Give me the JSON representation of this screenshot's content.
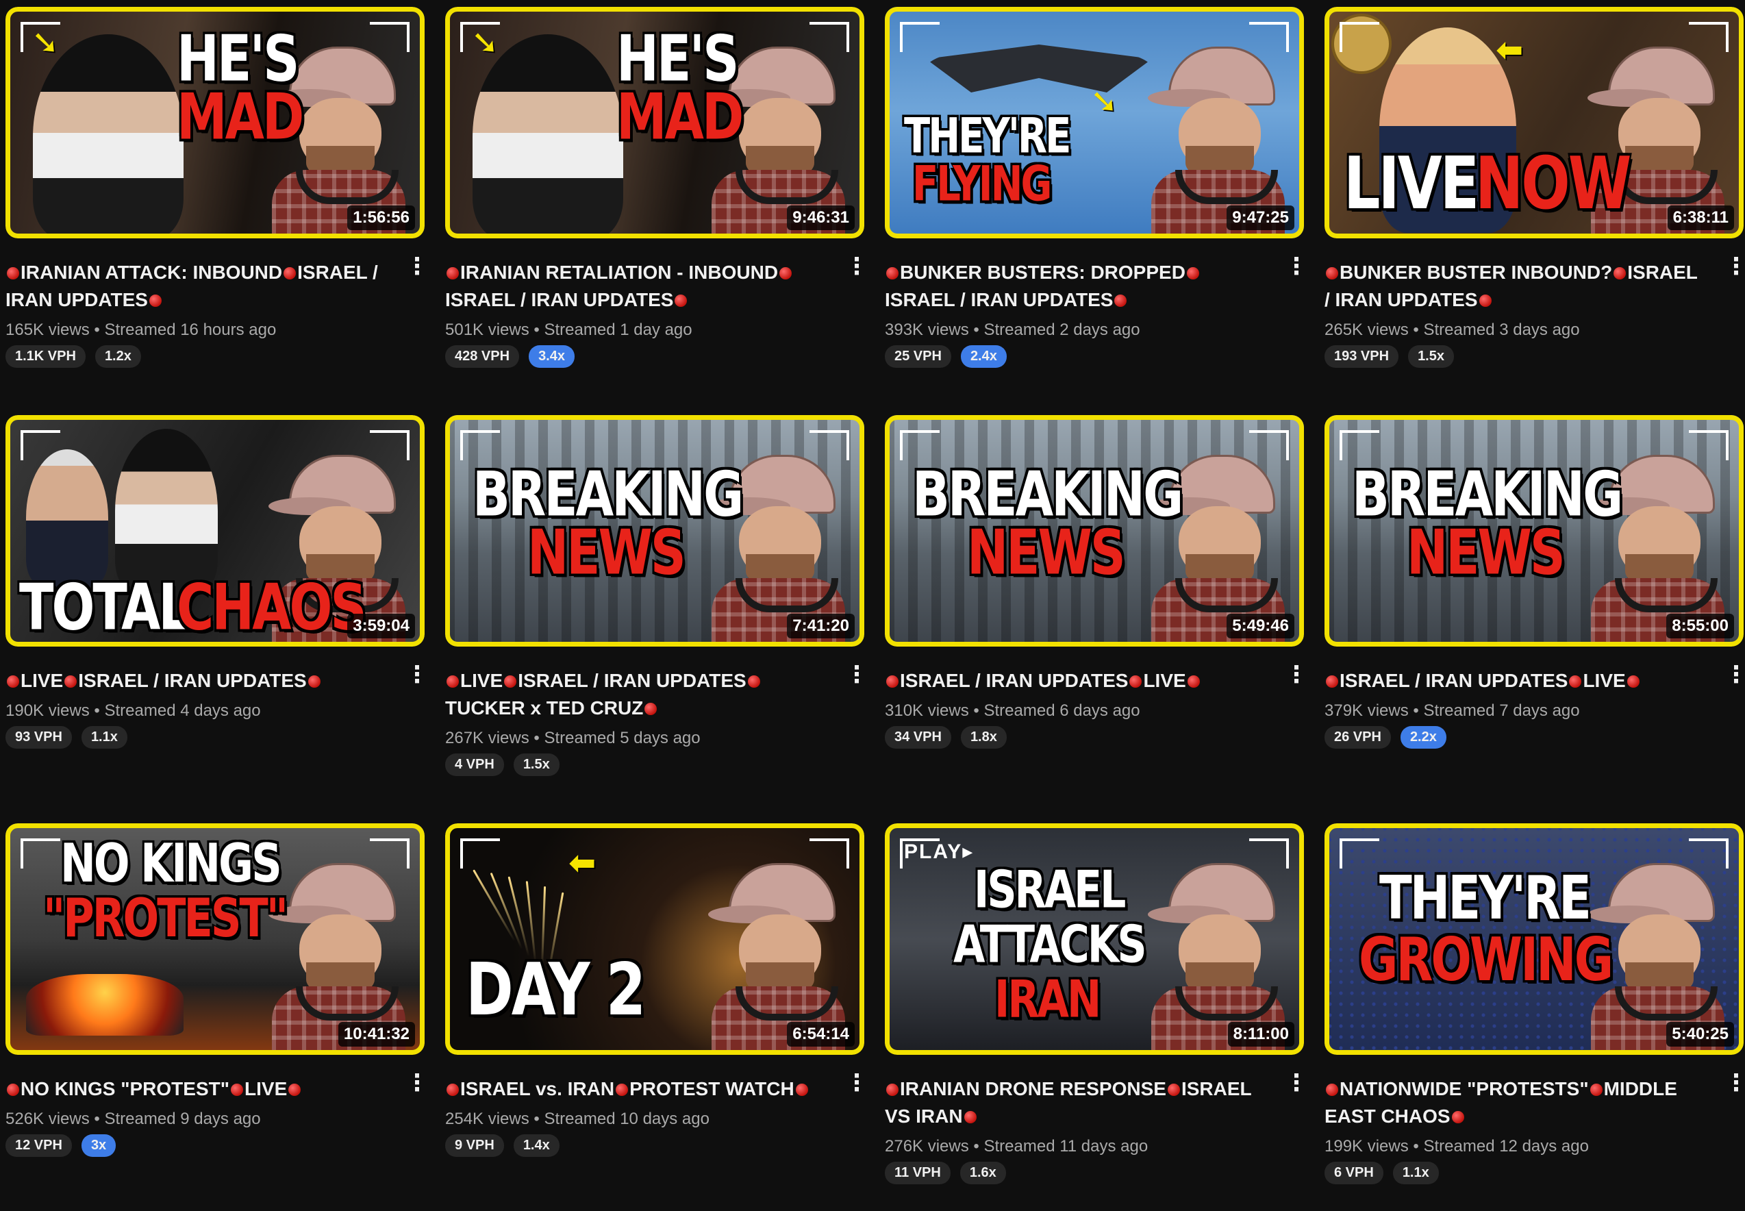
{
  "videos": [
    {
      "title": [
        "",
        "IRANIAN ATTACK: INBOUND",
        "ISRAEL / IRAN UPDATES",
        ""
      ],
      "views": "165K views",
      "streamed": "Streamed 16 hours ago",
      "vph": "1.1K VPH",
      "mult": "1.2x",
      "mult_hi": false,
      "duration": "1:56:56",
      "thumb_lines": [
        "HE'S",
        "MAD"
      ],
      "scene": "cleric"
    },
    {
      "title": [
        "",
        "IRANIAN RETALIATION - INBOUND",
        "ISRAEL / IRAN UPDATES",
        ""
      ],
      "views": "501K views",
      "streamed": "Streamed 1 day ago",
      "vph": "428 VPH",
      "mult": "3.4x",
      "mult_hi": true,
      "duration": "9:46:31",
      "thumb_lines": [
        "HE'S",
        "MAD"
      ],
      "scene": "cleric"
    },
    {
      "title": [
        "",
        "BUNKER BUSTERS: DROPPED",
        "ISRAEL / IRAN UPDATES",
        ""
      ],
      "views": "393K views",
      "streamed": "Streamed 2 days ago",
      "vph": "25 VPH",
      "mult": "2.4x",
      "mult_hi": true,
      "duration": "9:47:25",
      "thumb_lines": [
        "THEY'RE",
        "FLYING"
      ],
      "scene": "jet"
    },
    {
      "title": [
        "",
        "BUNKER BUSTER INBOUND?",
        "ISRAEL / IRAN UPDATES",
        ""
      ],
      "views": "265K views",
      "streamed": "Streamed 3 days ago",
      "vph": "193 VPH",
      "mult": "1.5x",
      "mult_hi": false,
      "duration": "6:38:11",
      "thumb_lines": [
        "LIVE",
        "NOW"
      ],
      "scene": "phone"
    },
    {
      "title": [
        "",
        "LIVE",
        "ISRAEL / IRAN UPDATES",
        ""
      ],
      "views": "190K views",
      "streamed": "Streamed 4 days ago",
      "vph": "93 VPH",
      "mult": "1.1x",
      "mult_hi": false,
      "duration": "3:59:04",
      "thumb_lines": [
        "TOTAL",
        "CHAOS"
      ],
      "scene": "chaos"
    },
    {
      "title": [
        "",
        "LIVE",
        "ISRAEL / IRAN UPDATES",
        "TUCKER x TED CRUZ",
        ""
      ],
      "views": "267K views",
      "streamed": "Streamed 5 days ago",
      "vph": "4 VPH",
      "mult": "1.5x",
      "mult_hi": false,
      "duration": "7:41:20",
      "thumb_lines": [
        "BREAKING",
        "NEWS"
      ],
      "scene": "city"
    },
    {
      "title": [
        "",
        "ISRAEL / IRAN UPDATES",
        "LIVE",
        ""
      ],
      "views": "310K views",
      "streamed": "Streamed 6 days ago",
      "vph": "34 VPH",
      "mult": "1.8x",
      "mult_hi": false,
      "duration": "5:49:46",
      "thumb_lines": [
        "BREAKING",
        "NEWS"
      ],
      "scene": "city"
    },
    {
      "title": [
        "",
        "ISRAEL / IRAN UPDATES",
        "LIVE",
        ""
      ],
      "views": "379K views",
      "streamed": "Streamed 7 days ago",
      "vph": "26 VPH",
      "mult": "2.2x",
      "mult_hi": true,
      "duration": "8:55:00",
      "thumb_lines": [
        "BREAKING",
        "NEWS"
      ],
      "scene": "city"
    },
    {
      "title": [
        "",
        "NO KINGS \"PROTEST\"",
        "LIVE",
        ""
      ],
      "views": "526K views",
      "streamed": "Streamed 9 days ago",
      "vph": "12 VPH",
      "mult": "3x",
      "mult_hi": true,
      "duration": "10:41:32",
      "thumb_lines": [
        "NO KINGS",
        "\"PROTEST\""
      ],
      "scene": "fire"
    },
    {
      "title": [
        "",
        "ISRAEL vs. IRAN",
        "PROTEST WATCH",
        ""
      ],
      "views": "254K views",
      "streamed": "Streamed 10 days ago",
      "vph": "9 VPH",
      "mult": "1.4x",
      "mult_hi": false,
      "duration": "6:54:14",
      "thumb_lines": [
        "DAY 2",
        ""
      ],
      "scene": "night"
    },
    {
      "title": [
        "",
        "IRANIAN DRONE RESPONSE",
        "ISRAEL VS IRAN",
        ""
      ],
      "views": "276K views",
      "streamed": "Streamed 11 days ago",
      "vph": "11 VPH",
      "mult": "1.6x",
      "mult_hi": false,
      "duration": "8:11:00",
      "thumb_lines": [
        "ISRAEL",
        "ATTACKS",
        "IRAN"
      ],
      "scene": "street",
      "tag": "PLAY"
    },
    {
      "title": [
        "",
        "NATIONWIDE \"PROTESTS\"",
        "MIDDLE EAST CHAOS",
        ""
      ],
      "views": "199K views",
      "streamed": "Streamed 12 days ago",
      "vph": "6 VPH",
      "mult": "1.1x",
      "mult_hi": false,
      "duration": "5:40:25",
      "thumb_lines": [
        "THEY'RE",
        "GROWING"
      ],
      "scene": "crowd"
    }
  ],
  "stats_separator": " • ",
  "menu_icon": "⋮",
  "colors": {
    "frame": "#f2e100",
    "accent_red": "#e8231a",
    "badge_hi": "#3e7de8",
    "badge": "#272727",
    "bg": "#0f0f0f"
  },
  "icons": [
    "more-vert-icon",
    "live-dot-icon",
    "yellow-arrow-icon"
  ]
}
